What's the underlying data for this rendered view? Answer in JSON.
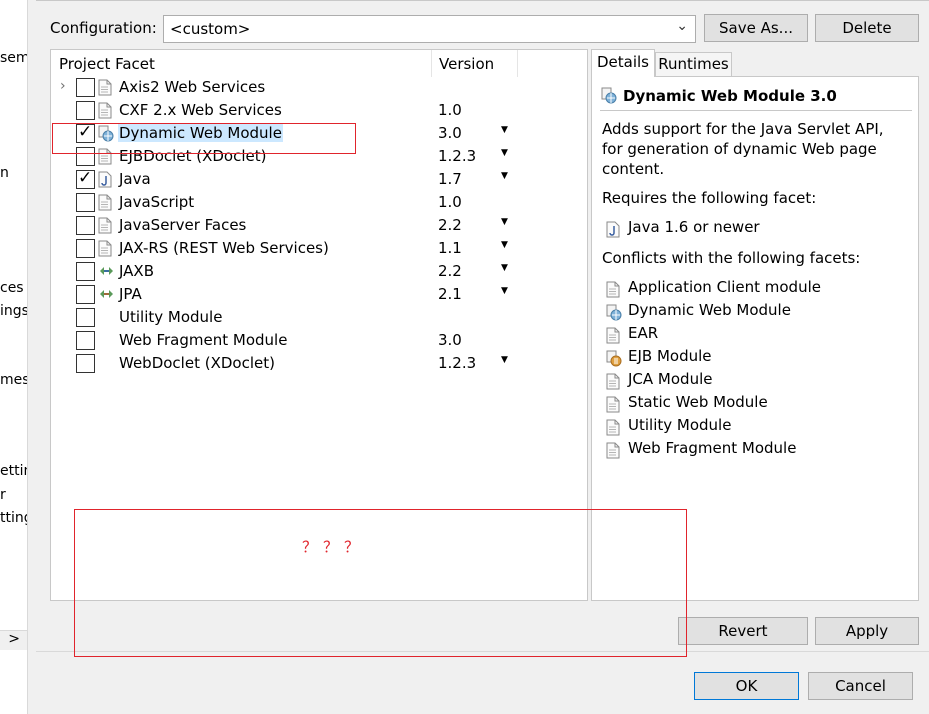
{
  "left_fragments": [
    "sem",
    "n",
    "ces",
    "ings",
    "mes",
    "etting",
    "r",
    "tting",
    ">"
  ],
  "configuration": {
    "label": "Configuration:",
    "value": "<custom>",
    "save_as": "Save As...",
    "delete": "Delete"
  },
  "table": {
    "col_facet": "Project Facet",
    "col_version": "Version",
    "rows": [
      {
        "label": "Axis2 Web Services",
        "version": "",
        "checked": false,
        "icon": "page-icon",
        "expand": true,
        "dropdown": false
      },
      {
        "label": "CXF 2.x Web Services",
        "version": "1.0",
        "checked": false,
        "icon": "page-icon",
        "dropdown": false
      },
      {
        "label": "Dynamic Web Module",
        "version": "3.0",
        "checked": true,
        "icon": "web-module-icon",
        "dropdown": true,
        "selected": true
      },
      {
        "label": "EJBDoclet (XDoclet)",
        "version": "1.2.3",
        "checked": false,
        "icon": "page-icon",
        "dropdown": true
      },
      {
        "label": "Java",
        "version": "1.7",
        "checked": true,
        "icon": "java-icon",
        "dropdown": true
      },
      {
        "label": "JavaScript",
        "version": "1.0",
        "checked": false,
        "icon": "page-icon",
        "dropdown": false
      },
      {
        "label": "JavaServer Faces",
        "version": "2.2",
        "checked": false,
        "icon": "page-icon",
        "dropdown": true
      },
      {
        "label": "JAX-RS (REST Web Services)",
        "version": "1.1",
        "checked": false,
        "icon": "page-icon",
        "dropdown": true
      },
      {
        "label": "JAXB",
        "version": "2.2",
        "checked": false,
        "icon": "jaxb-icon",
        "dropdown": true
      },
      {
        "label": "JPA",
        "version": "2.1",
        "checked": false,
        "icon": "jpa-icon",
        "dropdown": true
      },
      {
        "label": "Utility Module",
        "version": "",
        "checked": false,
        "icon": "",
        "dropdown": false
      },
      {
        "label": "Web Fragment Module",
        "version": "3.0",
        "checked": false,
        "icon": "",
        "dropdown": false
      },
      {
        "label": "WebDoclet (XDoclet)",
        "version": "1.2.3",
        "checked": false,
        "icon": "",
        "dropdown": true
      }
    ]
  },
  "details": {
    "tab_details": "Details",
    "tab_runtimes": "Runtimes",
    "title": "Dynamic Web Module 3.0",
    "desc": "Adds support for the Java Servlet API, for generation of dynamic Web page content.",
    "requires_label": "Requires the following facet:",
    "requires": [
      {
        "label": "Java 1.6 or newer",
        "icon": "java-icon"
      }
    ],
    "conflicts_label": "Conflicts with the following facets:",
    "conflicts": [
      {
        "label": "Application Client module",
        "icon": "page-icon"
      },
      {
        "label": "Dynamic Web Module",
        "icon": "web-module-icon"
      },
      {
        "label": "EAR",
        "icon": "page-icon"
      },
      {
        "label": "EJB Module",
        "icon": "ejb-icon"
      },
      {
        "label": "JCA Module",
        "icon": "page-icon"
      },
      {
        "label": "Static Web Module",
        "icon": "page-icon"
      },
      {
        "label": "Utility Module",
        "icon": "page-icon"
      },
      {
        "label": "Web Fragment Module",
        "icon": "page-icon"
      }
    ]
  },
  "buttons": {
    "revert": "Revert",
    "apply": "Apply",
    "ok": "OK",
    "cancel": "Cancel"
  },
  "annotation": {
    "text": "？？？",
    "color": "#e0242c"
  },
  "colors": {
    "selection": "#cce8ff",
    "focus": "#0078d7"
  }
}
